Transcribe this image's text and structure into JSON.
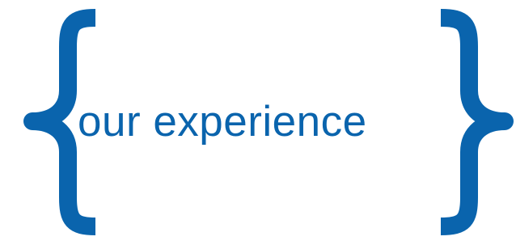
{
  "banner": {
    "text": "our experience",
    "brand_color": "#0a64ad",
    "left_icon": "left-curly-brace-icon",
    "right_icon": "right-curly-brace-icon"
  }
}
